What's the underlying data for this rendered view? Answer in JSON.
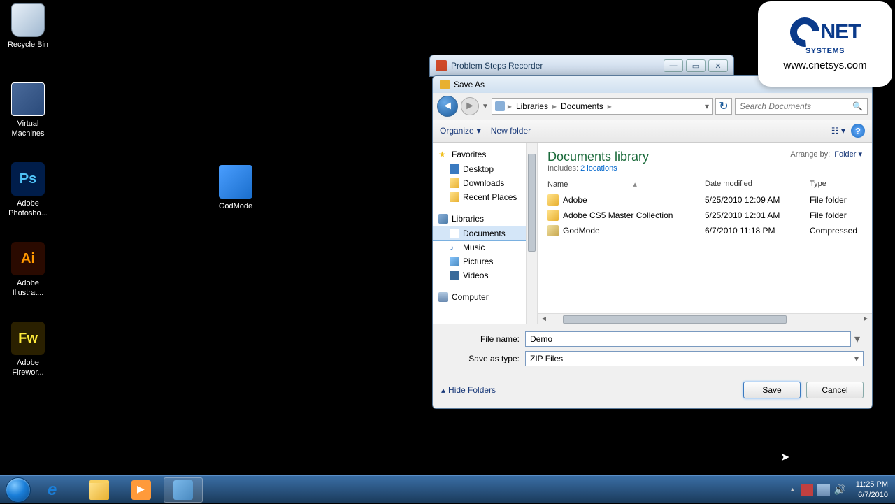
{
  "desktop": {
    "icons": [
      {
        "label": "Recycle Bin"
      },
      {
        "label": "Virtual Machines"
      },
      {
        "label": "Adobe Photosho..."
      },
      {
        "label": "Adobe Illustrat..."
      },
      {
        "label": "Adobe Firewor..."
      },
      {
        "label": "GodMode"
      }
    ]
  },
  "psr": {
    "title": "Problem Steps Recorder"
  },
  "dialog": {
    "title": "Save As",
    "breadcrumb": {
      "root": "Libraries",
      "current": "Documents"
    },
    "search_placeholder": "Search Documents",
    "toolbar": {
      "organize": "Organize",
      "new_folder": "New folder"
    },
    "library": {
      "title": "Documents library",
      "includes_label": "Includes:",
      "includes_link": "2 locations",
      "arrange_label": "Arrange by:",
      "arrange_value": "Folder"
    },
    "sidebar": {
      "favorites": "Favorites",
      "desktop": "Desktop",
      "downloads": "Downloads",
      "recent": "Recent Places",
      "libraries": "Libraries",
      "documents": "Documents",
      "music": "Music",
      "pictures": "Pictures",
      "videos": "Videos",
      "computer": "Computer"
    },
    "columns": {
      "name": "Name",
      "date": "Date modified",
      "type": "Type"
    },
    "files": [
      {
        "name": "Adobe",
        "date": "5/25/2010 12:09 AM",
        "type": "File folder"
      },
      {
        "name": "Adobe CS5 Master Collection",
        "date": "5/25/2010 12:01 AM",
        "type": "File folder"
      },
      {
        "name": "GodMode",
        "date": "6/7/2010 11:18 PM",
        "type": "Compressed"
      }
    ],
    "filename_label": "File name:",
    "filename_value": "Demo",
    "savetype_label": "Save as type:",
    "savetype_value": "ZIP Files",
    "hide_folders": "Hide Folders",
    "save": "Save",
    "cancel": "Cancel"
  },
  "taskbar": {
    "time": "11:25 PM",
    "date": "6/7/2010"
  },
  "logo": {
    "brand": "NET",
    "tag": "SYSTEMS",
    "url": "www.cnetsys.com"
  }
}
